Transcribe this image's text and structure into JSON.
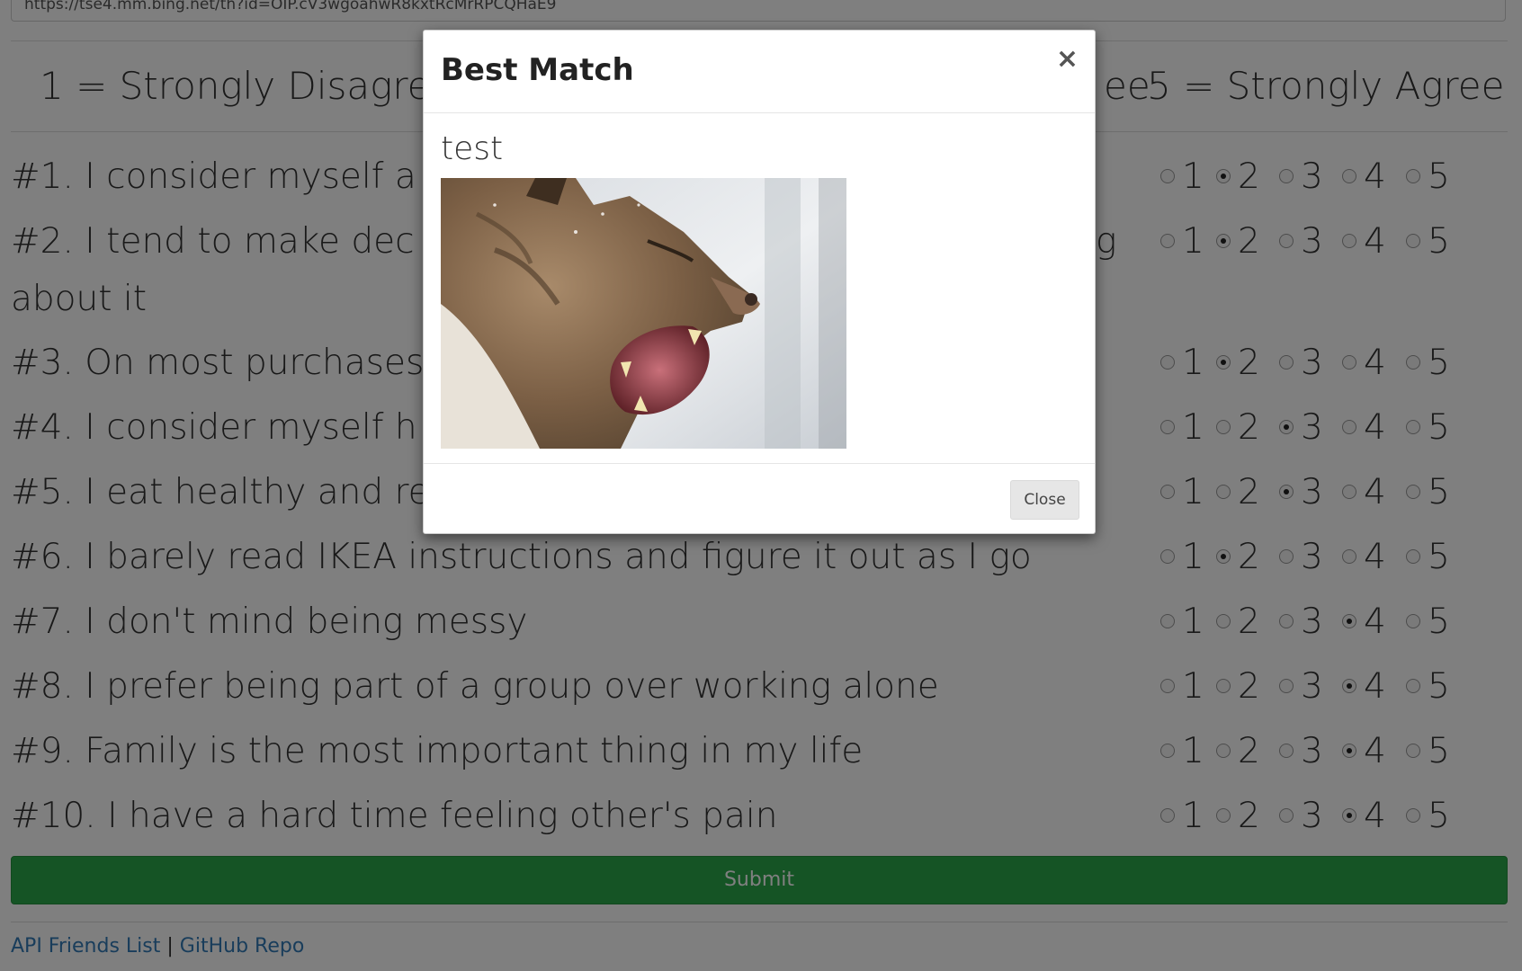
{
  "url_field": {
    "value": "https://tse4.mm.bing.net/th?id=OIP.cV3wgoahwR8kxtRcMrRPCQHaE9"
  },
  "scale": {
    "left_label": "1 = Strongly Disagree",
    "right_label_partial": "ee",
    "right_label": "5 = Strongly Agree"
  },
  "questions": [
    {
      "text": "#1. I consider myself a",
      "selected": 2
    },
    {
      "text": "#2. I tend to make dec",
      "tail": "g",
      "wrap": "about it",
      "selected": 2
    },
    {
      "text": "#3. On most purchases",
      "selected": 2
    },
    {
      "text": "#4. I consider myself h",
      "selected": 3
    },
    {
      "text": "#5. I eat healthy and re",
      "selected": 3
    },
    {
      "text": "#6. I barely read IKEA instructions and figure it out as I go",
      "selected": 2
    },
    {
      "text": "#7. I don't mind being messy",
      "selected": 4
    },
    {
      "text": "#8. I prefer being part of a group over working alone",
      "selected": 4
    },
    {
      "text": "#9. Family is the most important thing in my life",
      "selected": 4
    },
    {
      "text": "#10. I have a hard time feeling other's pain",
      "selected": 4
    }
  ],
  "options": [
    "1",
    "2",
    "3",
    "4",
    "5"
  ],
  "submit_label": "Submit",
  "footer": {
    "link1": "API Friends List",
    "separator": "|",
    "link2": "GitHub Repo"
  },
  "modal": {
    "title": "Best Match",
    "close_symbol": "×",
    "body_text": "test",
    "image_icon": "lynx-photo",
    "close_label": "Close"
  }
}
